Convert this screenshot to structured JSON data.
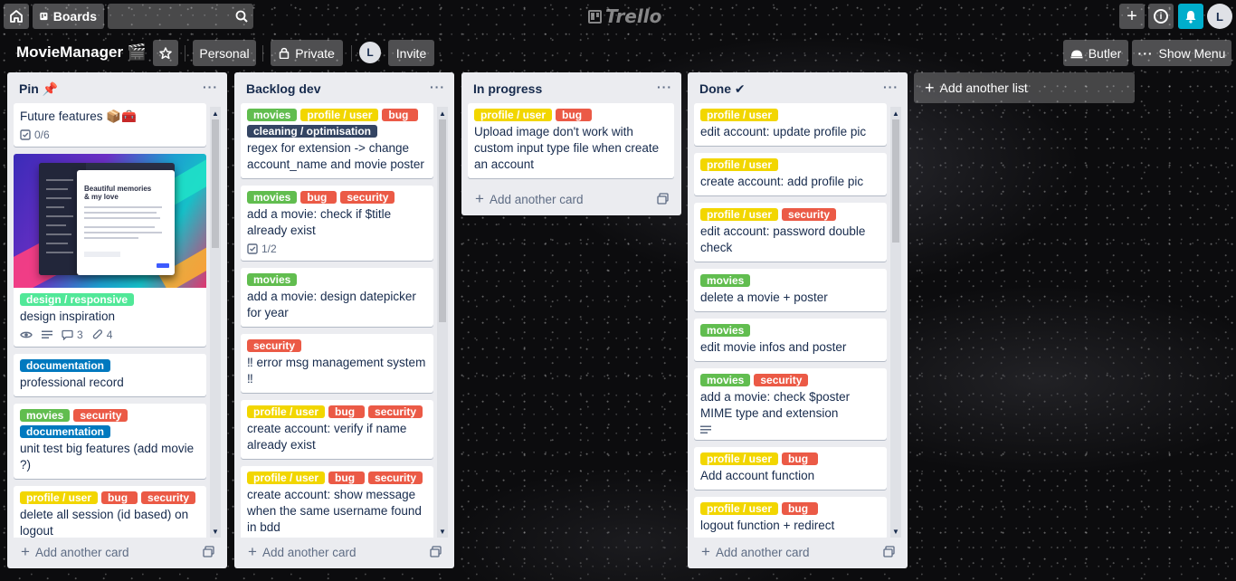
{
  "topbar": {
    "boards_label": "Boards",
    "search_value": "",
    "logo_text": "Trello",
    "avatar_initial": "L",
    "bell_color": "#00aecc"
  },
  "board": {
    "title": "MovieManager 🎬",
    "visibility_team": "Personal",
    "visibility_privacy": "Private",
    "member_initial": "L",
    "invite_label": "Invite",
    "butler_label": "Butler",
    "show_menu_label": "Show Menu",
    "add_list_label": "Add another list"
  },
  "label_colors": {
    "movies": "#61bd4f",
    "profile / user": "#f2d600",
    "bug": "#eb5a46",
    "security": "#eb5a46",
    "cleaning / optimisation": "#344563",
    "design / responsive": "#51e898",
    "documentation": "#0079bf"
  },
  "footer_label": "Add another card",
  "lists": [
    {
      "title": "Pin 📌",
      "cards": [
        {
          "title": "Future features 📦🧰",
          "labels": [],
          "badges": {
            "checklist": "0/6"
          }
        },
        {
          "title": "design inspiration",
          "labels": [
            "design / responsive"
          ],
          "cover": true,
          "badges": {
            "watch": true,
            "description": true,
            "comments": "3",
            "attachments": "4"
          }
        },
        {
          "title": "professional record",
          "labels": [
            "documentation"
          ]
        },
        {
          "title": "unit test big features (add movie ?)",
          "labels": [
            "movies",
            "security",
            "documentation"
          ]
        },
        {
          "title": "delete all session (id based) on logout",
          "labels": [
            "profile / user",
            "bug",
            "security"
          ]
        }
      ]
    },
    {
      "title": "Backlog dev",
      "cards": [
        {
          "title": "regex for extension -> change account_name and movie poster",
          "labels": [
            "movies",
            "profile / user",
            "bug",
            "cleaning / optimisation"
          ]
        },
        {
          "title": "add a movie: check if $title already exist",
          "labels": [
            "movies",
            "bug",
            "security"
          ],
          "badges": {
            "checklist": "1/2"
          }
        },
        {
          "title": "add a movie: design datepicker for year",
          "labels": [
            "movies"
          ]
        },
        {
          "title": "‼ error msg management system ‼",
          "labels": [
            "security"
          ]
        },
        {
          "title": "create account: verify if name already exist",
          "labels": [
            "profile / user",
            "bug",
            "security"
          ]
        },
        {
          "title": "create account: show message when the same username found in bdd",
          "labels": [
            "profile / user",
            "bug",
            "security"
          ]
        }
      ]
    },
    {
      "title": "In progress",
      "cards": [
        {
          "title": "Upload image don't work with custom input type file when create an account",
          "labels": [
            "profile / user",
            "bug"
          ]
        }
      ]
    },
    {
      "title": "Done ✔",
      "cards": [
        {
          "title": "edit account: update profile pic",
          "labels": [
            "profile / user"
          ]
        },
        {
          "title": "create account: add profile pic",
          "labels": [
            "profile / user"
          ]
        },
        {
          "title": "edit account: password double check",
          "labels": [
            "profile / user",
            "security"
          ]
        },
        {
          "title": "delete a movie + poster",
          "labels": [
            "movies"
          ]
        },
        {
          "title": "edit movie infos and poster",
          "labels": [
            "movies"
          ]
        },
        {
          "title": "add a movie: check $poster MIME type and extension",
          "labels": [
            "movies",
            "security"
          ],
          "badges": {
            "description": true
          }
        },
        {
          "title": "Add account function",
          "labels": [
            "profile / user",
            "bug"
          ]
        },
        {
          "title": "logout function + redirect",
          "labels": [
            "profile / user",
            "bug"
          ]
        }
      ]
    }
  ],
  "cover_mock": {
    "heading_line1": "Beautiful memories",
    "heading_line2": "& my love"
  }
}
